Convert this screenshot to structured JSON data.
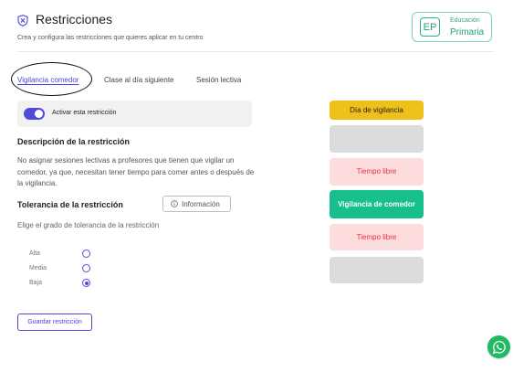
{
  "header": {
    "title": "Restricciones",
    "subtitle": "Crea y configura las restricciones que quieres aplicar en tu centro",
    "title_icon": "shield-x-icon"
  },
  "school_badge": {
    "initials": "EP",
    "line1": "Educación",
    "line2": "Primaria",
    "accent_color": "#2eae86"
  },
  "tabs": [
    {
      "label": "Vigilancia comedor",
      "active": true
    },
    {
      "label": "Clase al día siguiente",
      "active": false
    },
    {
      "label": "Sesión lectiva",
      "active": false
    }
  ],
  "toggle": {
    "label": "Activar esta restricción",
    "on": true,
    "color": "#5149d9"
  },
  "description": {
    "heading": "Descripción de la restricción",
    "text": "No asignar sesiones lectivas a profesores que tienen que vigilar un comedor, ya que, necesitan tener tiempo para comer antes o después de la vigilancia."
  },
  "tolerance": {
    "heading": "Tolerancia de la restricción",
    "info_button": "Información",
    "info_icon": "info-circle-icon",
    "description": "Elige el grado de tolerancia de la restricción",
    "options": [
      {
        "label": "Alta",
        "selected": false
      },
      {
        "label": "Media",
        "selected": false
      },
      {
        "label": "Baja",
        "selected": true
      }
    ]
  },
  "save_button": "Guardar restricción",
  "schedule": {
    "dia_vigilancia": "Día de vigilancia",
    "tiempo_libre_1": "Tiempo libre",
    "vigilancia_comedor": "Vigilancia de comedor",
    "tiempo_libre_2": "Tiempo libre",
    "colors": {
      "vigilancia": "#f0c01a",
      "libre": "#fcdcdc",
      "comedor": "#17bf8d",
      "empty": "#dcdcdc"
    }
  },
  "whatsapp_icon": "whatsapp-icon"
}
